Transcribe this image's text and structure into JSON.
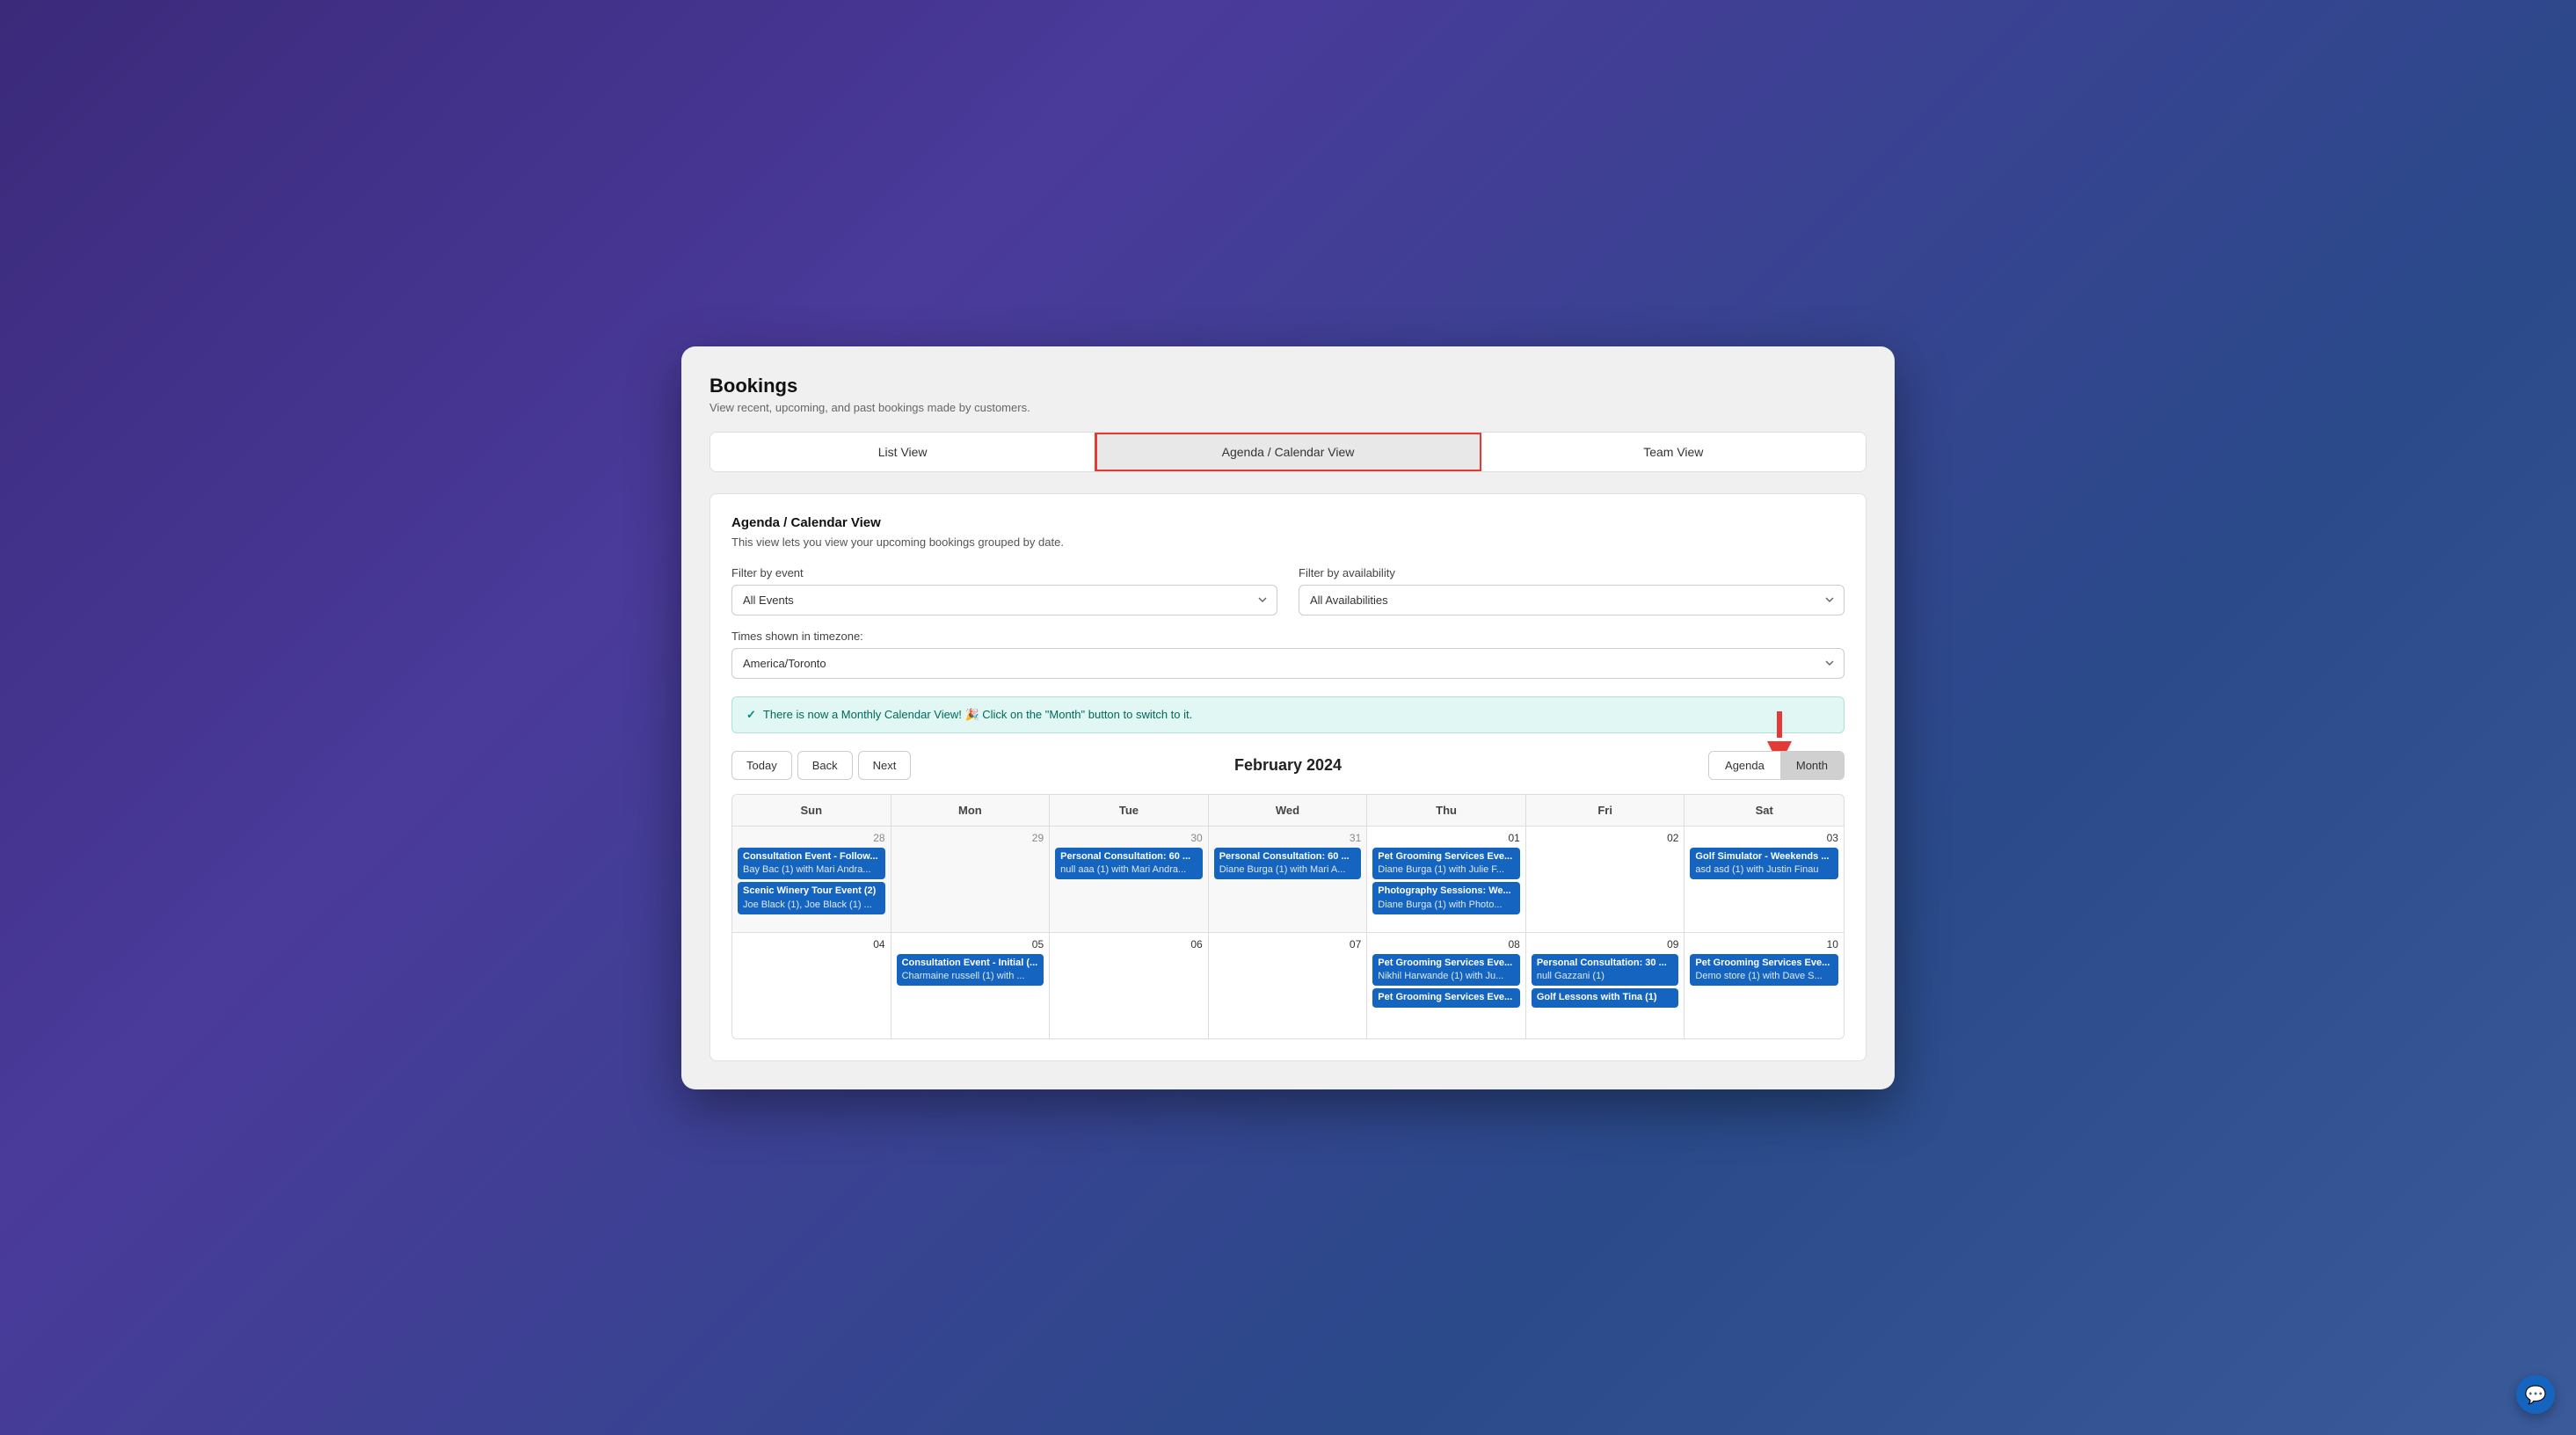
{
  "page": {
    "title": "Bookings",
    "subtitle": "View recent, upcoming, and past bookings made by customers."
  },
  "tabs": [
    {
      "id": "list",
      "label": "List View",
      "active": false
    },
    {
      "id": "agenda",
      "label": "Agenda / Calendar View",
      "active": true
    },
    {
      "id": "team",
      "label": "Team View",
      "active": false
    }
  ],
  "panel": {
    "title": "Agenda / Calendar View",
    "description": "This view lets you view your upcoming bookings grouped by date."
  },
  "filters": {
    "event_label": "Filter by event",
    "event_value": "All Events",
    "availability_label": "Filter by availability",
    "availability_value": "All Availabilities",
    "timezone_label": "Times shown in timezone:",
    "timezone_value": "America/Toronto"
  },
  "banner": {
    "text": "There is now a Monthly Calendar View! 🎉 Click on the \"Month\" button to switch to it."
  },
  "calendar": {
    "nav": {
      "today": "Today",
      "back": "Back",
      "next": "Next"
    },
    "month_title": "February 2024",
    "view_options": [
      "Agenda",
      "Month"
    ],
    "active_view": "Month",
    "headers": [
      "Sun",
      "Mon",
      "Tue",
      "Wed",
      "Thu",
      "Fri",
      "Sat"
    ],
    "weeks": [
      {
        "days": [
          {
            "number": "28",
            "other_month": true,
            "events": [
              {
                "title": "Consultation Event - Follow...",
                "sub": "Bay Bac (1) with Mari Andra..."
              },
              {
                "title": "Scenic Winery Tour Event (2)",
                "sub": "Joe Black (1), Joe Black (1) ..."
              }
            ]
          },
          {
            "number": "29",
            "other_month": true,
            "events": []
          },
          {
            "number": "30",
            "other_month": true,
            "events": [
              {
                "title": "Personal Consultation: 60 ...",
                "sub": "null aaa (1) with Mari Andra..."
              }
            ]
          },
          {
            "number": "31",
            "other_month": true,
            "events": [
              {
                "title": "Personal Consultation: 60 ...",
                "sub": "Diane Burga (1) with Mari A..."
              }
            ]
          },
          {
            "number": "01",
            "other_month": false,
            "events": [
              {
                "title": "Pet Grooming Services Eve...",
                "sub": "Diane Burga (1) with Julie F..."
              },
              {
                "title": "Photography Sessions: We...",
                "sub": "Diane Burga (1) with Photo..."
              }
            ]
          },
          {
            "number": "02",
            "other_month": false,
            "events": []
          },
          {
            "number": "03",
            "other_month": false,
            "events": [
              {
                "title": "Golf Simulator - Weekends ...",
                "sub": "asd asd (1) with Justin Finau"
              }
            ]
          }
        ]
      },
      {
        "days": [
          {
            "number": "04",
            "other_month": false,
            "events": []
          },
          {
            "number": "05",
            "other_month": false,
            "events": [
              {
                "title": "Consultation Event - Initial (...",
                "sub": "Charmaine russell (1) with ..."
              }
            ]
          },
          {
            "number": "06",
            "other_month": false,
            "events": []
          },
          {
            "number": "07",
            "other_month": false,
            "events": []
          },
          {
            "number": "08",
            "other_month": false,
            "events": [
              {
                "title": "Pet Grooming Services Eve...",
                "sub": "Nikhil Harwande (1) with Ju..."
              },
              {
                "title": "Pet Grooming Services Eve...",
                "sub": ""
              }
            ]
          },
          {
            "number": "09",
            "other_month": false,
            "events": [
              {
                "title": "Personal Consultation: 30 ...",
                "sub": "null Gazzani (1)"
              },
              {
                "title": "Golf Lessons with Tina (1)",
                "sub": ""
              }
            ]
          },
          {
            "number": "10",
            "other_month": false,
            "events": [
              {
                "title": "Pet Grooming Services Eve...",
                "sub": "Demo store (1) with Dave S..."
              }
            ]
          }
        ]
      }
    ]
  }
}
